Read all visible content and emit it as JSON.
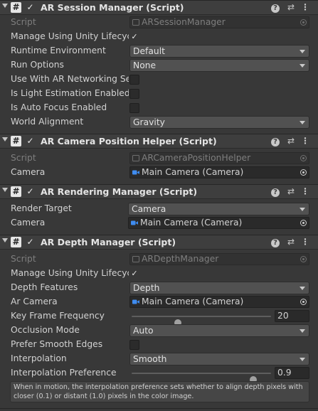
{
  "components": [
    {
      "title": "AR Session Manager (Script)",
      "fields": [
        {
          "label": "Script",
          "value": "ARSessionManager"
        },
        {
          "label": "Manage Using Unity Lifecycle",
          "checked": true
        },
        {
          "label": "Runtime Environment",
          "value": "Default"
        },
        {
          "label": "Run Options",
          "value": "None"
        },
        {
          "label": "Use With AR Networking Session",
          "checked": false
        },
        {
          "label": "Is Light Estimation Enabled",
          "checked": false
        },
        {
          "label": "Is Auto Focus Enabled",
          "checked": false
        },
        {
          "label": "World Alignment",
          "value": "Gravity"
        }
      ]
    },
    {
      "title": "AR Camera Position Helper (Script)",
      "fields": [
        {
          "label": "Script",
          "value": "ARCameraPositionHelper"
        },
        {
          "label": "Camera",
          "value": "Main Camera (Camera)"
        }
      ]
    },
    {
      "title": "AR Rendering Manager (Script)",
      "fields": [
        {
          "label": "Render Target",
          "value": "Camera"
        },
        {
          "label": "Camera",
          "value": "Main Camera (Camera)"
        }
      ]
    },
    {
      "title": "AR Depth Manager (Script)",
      "fields": [
        {
          "label": "Script",
          "value": "ARDepthManager"
        },
        {
          "label": "Manage Using Unity Lifecycle",
          "checked": true
        },
        {
          "label": "Depth Features",
          "value": "Depth"
        },
        {
          "label": "Ar Camera",
          "value": "Main Camera (Camera)"
        },
        {
          "label": "Key Frame Frequency",
          "value": "20",
          "slider_fraction": 0.33
        },
        {
          "label": "Occlusion Mode",
          "value": "Auto"
        },
        {
          "label": "Prefer Smooth Edges",
          "checked": false
        },
        {
          "label": "Interpolation",
          "value": "Smooth"
        },
        {
          "label": "Interpolation Preference",
          "value": "0.9",
          "slider_fraction": 0.87
        }
      ],
      "help_text": "When in motion, the interpolation preference sets whether to align depth pixels with closer (0.1) or distant (1.0) pixels in the color image."
    }
  ],
  "glyphs": {
    "check": "✓",
    "script": "#",
    "help": "?",
    "presets": "⇄",
    "menu": "⋮"
  },
  "icons": [
    "fold-arrow-icon",
    "script-icon",
    "help-icon",
    "presets-icon",
    "kebab-menu-icon",
    "camera-icon",
    "object-picker-icon",
    "dropdown-arrow-icon"
  ],
  "colors": {
    "background": "#383838",
    "header": "#3e3e3e",
    "field": "#2a2a2a",
    "dropdown": "#515151",
    "camera_icon": "#3f8cf0"
  }
}
